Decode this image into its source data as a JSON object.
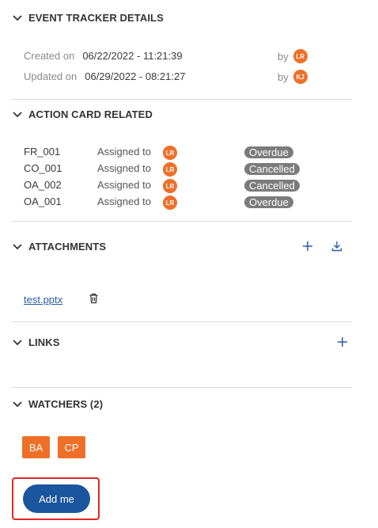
{
  "event_tracker": {
    "title": "EVENT TRACKER DETAILS",
    "created_label": "Created on",
    "created_value": "06/22/2022 - 11:21:39",
    "created_by_label": "by",
    "created_by_initials": "LR",
    "updated_label": "Updated on",
    "updated_value": "06/29/2022 - 08:21:27",
    "updated_by_label": "by",
    "updated_by_initials": "KJ"
  },
  "action_card": {
    "title": "ACTION CARD RELATED",
    "rows": [
      {
        "code": "FR_001",
        "assigned_label": "Assigned to",
        "initials": "LR",
        "status": "Overdue"
      },
      {
        "code": "CO_001",
        "assigned_label": "Assigned to",
        "initials": "LR",
        "status": "Cancelled"
      },
      {
        "code": "OA_002",
        "assigned_label": "Assigned to",
        "initials": "LR",
        "status": "Cancelled"
      },
      {
        "code": "OA_001",
        "assigned_label": "Assigned to",
        "initials": "LR",
        "status": "Overdue"
      }
    ]
  },
  "attachments": {
    "title": "ATTACHMENTS",
    "files": [
      {
        "name": "test.pptx"
      }
    ],
    "add_icon": "plus-icon",
    "download_icon": "download-icon",
    "delete_icon": "trash-icon"
  },
  "links": {
    "title": "LINKS",
    "add_icon": "plus-icon"
  },
  "watchers": {
    "title": "WATCHERS (2)",
    "items": [
      {
        "initials": "BA"
      },
      {
        "initials": "CP"
      }
    ],
    "add_me_label": "Add me"
  },
  "colors": {
    "avatar": "#ee7028",
    "status_badge": "#7b7b7b",
    "primary_button": "#1b559d",
    "link": "#2a5ea8",
    "highlight": "#e0262a"
  }
}
